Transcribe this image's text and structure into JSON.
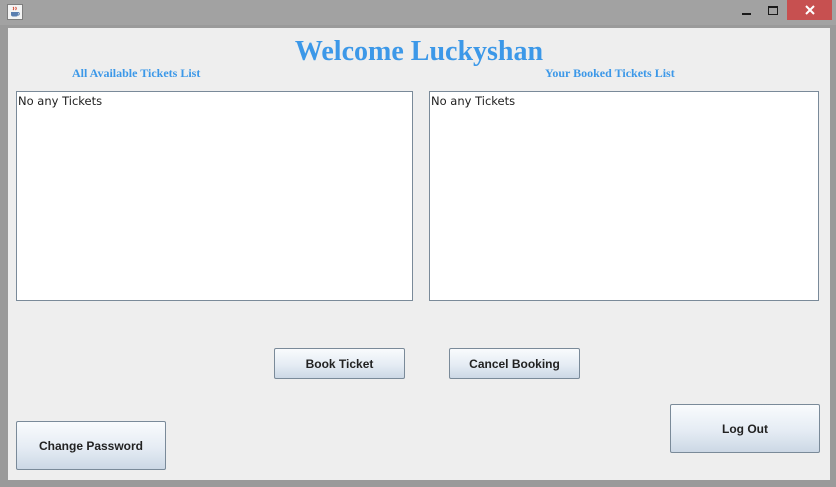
{
  "window": {
    "close_color": "#c75050",
    "app_icon": "java-cup-icon"
  },
  "header": {
    "welcome_text": "Welcome Luckyshan",
    "accent_color": "#3c98e8"
  },
  "available_list": {
    "label": "All Available Tickets List",
    "items": [
      "No any Tickets"
    ]
  },
  "booked_list": {
    "label": "Your Booked Tickets List",
    "items": [
      "No any Tickets"
    ]
  },
  "buttons": {
    "book": "Book Ticket",
    "cancel": "Cancel Booking",
    "change_password": "Change Password",
    "logout": "Log Out"
  }
}
